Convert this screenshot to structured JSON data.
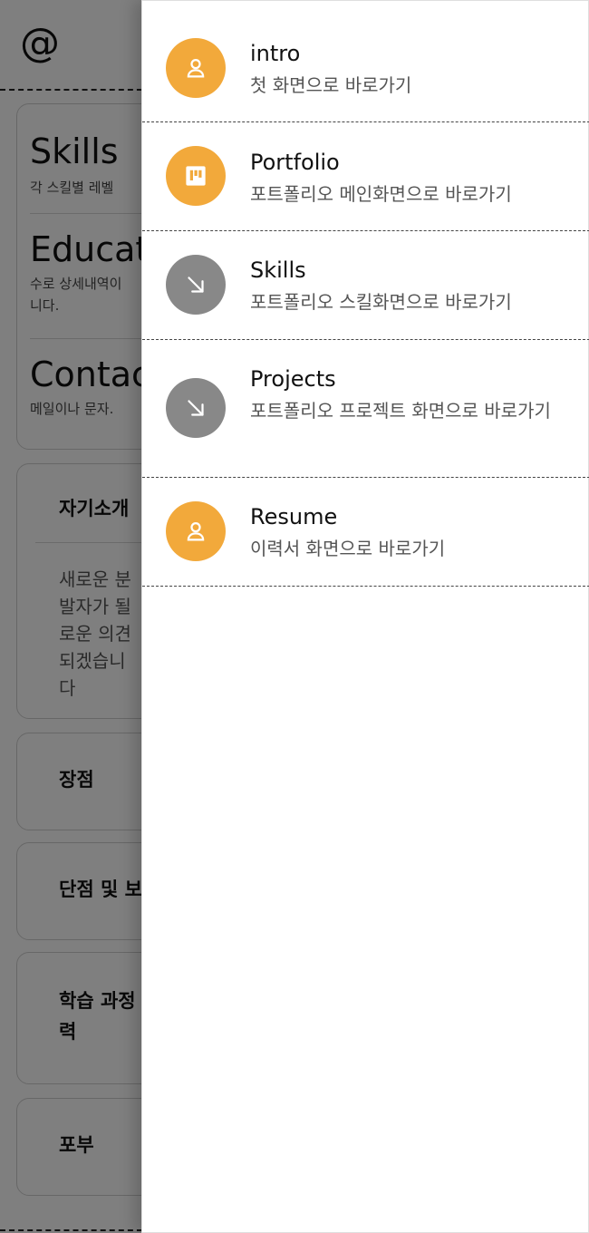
{
  "page": {
    "logo": "@",
    "nav_card": [
      {
        "title": "Skills",
        "desc": "각 스킬별 레벨"
      },
      {
        "title": "Education",
        "desc": "수로 상세내역이 니다."
      },
      {
        "title": "Contact",
        "desc": "메일이나 문자."
      }
    ],
    "intro": {
      "title": "자기소개",
      "body": "새로운 분 발자가 될 로운 의견 되겠습니다"
    },
    "accordions": [
      "장점",
      "단점 및 보",
      "학습 과정 력",
      "포부"
    ]
  },
  "drawer": {
    "items": [
      {
        "label": "intro",
        "subtitle": "첫 화면으로 바로가기",
        "icon": "user-icon",
        "color": "#F2A93B"
      },
      {
        "label": "Portfolio",
        "subtitle": "포트폴리오 메인화면으로 바로가기",
        "icon": "board-icon",
        "color": "#F2A93B"
      },
      {
        "label": "Skills",
        "subtitle": "포트폴리오 스킬화면으로 바로가기",
        "icon": "arrow-down-right-icon",
        "color": "#888888"
      },
      {
        "label": "Projects",
        "subtitle": "포트폴리오 프로젝트 화면으로 바로가기",
        "icon": "arrow-down-right-icon",
        "color": "#888888"
      },
      {
        "label": "Resume",
        "subtitle": "이력서 화면으로 바로가기",
        "icon": "user-icon",
        "color": "#F2A93B"
      }
    ]
  },
  "colors": {
    "accent": "#F2A93B",
    "inactive": "#888888",
    "scrim": "#000000"
  }
}
